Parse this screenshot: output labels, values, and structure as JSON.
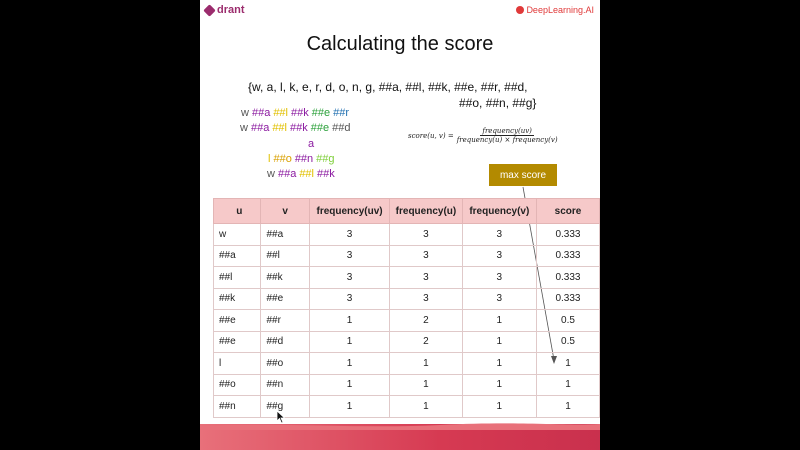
{
  "logos": {
    "left": "drant",
    "right": "DeepLearning.AI"
  },
  "title": "Calculating the score",
  "vocab_set": {
    "line1": "{w, a, l, k, e, r, d, o, n, g, ##a, ##l, ##k, ##e, ##r, ##d,",
    "line2": "##o, ##n, ##g}"
  },
  "tokenized": {
    "walker": [
      "w",
      "##a",
      "##l",
      "##k",
      "##e",
      "##r"
    ],
    "walked_1": [
      "w",
      "##a",
      "##l",
      "##k",
      "##e",
      "##d"
    ],
    "a": [
      "a"
    ],
    "long": [
      "l",
      "##o",
      "##n",
      "##g"
    ],
    "walk": [
      "w",
      "##a",
      "##l",
      "##k"
    ]
  },
  "formula": {
    "lhs": "score(u, v) =",
    "numerator": "frequency(uv)",
    "denominator": "frequency(u) × frequency(v)"
  },
  "max_score_label": "max score",
  "table": {
    "headers": [
      "u",
      "v",
      "frequency(uv)",
      "frequency(u)",
      "frequency(v)",
      "score"
    ],
    "rows": [
      [
        "w",
        "##a",
        "3",
        "3",
        "3",
        "0.333"
      ],
      [
        "##a",
        "##l",
        "3",
        "3",
        "3",
        "0.333"
      ],
      [
        "##l",
        "##k",
        "3",
        "3",
        "3",
        "0.333"
      ],
      [
        "##k",
        "##e",
        "3",
        "3",
        "3",
        "0.333"
      ],
      [
        "##e",
        "##r",
        "1",
        "2",
        "1",
        "0.5"
      ],
      [
        "##e",
        "##d",
        "1",
        "2",
        "1",
        "0.5"
      ],
      [
        "l",
        "##o",
        "1",
        "1",
        "1",
        "1"
      ],
      [
        "##o",
        "##n",
        "1",
        "1",
        "1",
        "1"
      ],
      [
        "##n",
        "##g",
        "1",
        "1",
        "1",
        "1"
      ]
    ]
  },
  "colors": {
    "accent": "#b38a00",
    "header_bg": "#f6c9c9",
    "footer": "#d63a52",
    "brand_left": "#9b2c6d",
    "brand_right": "#e03a3a"
  }
}
